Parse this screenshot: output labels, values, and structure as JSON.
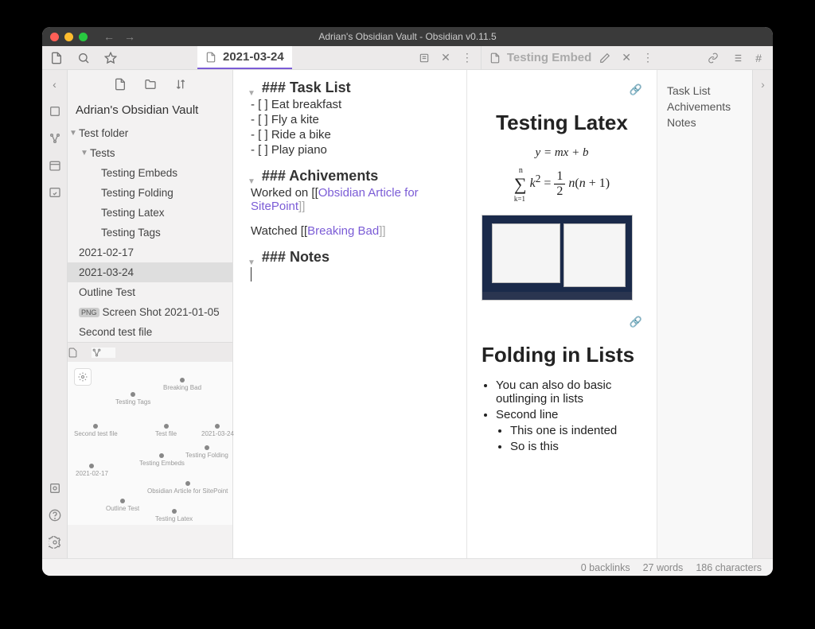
{
  "window": {
    "title": "Adrian's Obsidian Vault - Obsidian v0.11.5"
  },
  "tabs": {
    "editor": {
      "title": "2021-03-24"
    },
    "preview": {
      "title": "Testing Embed"
    }
  },
  "vault": {
    "name": "Adrian's Obsidian Vault"
  },
  "tree": {
    "root": "Test folder",
    "tests_folder": "Tests",
    "items": [
      "Testing Embeds",
      "Testing Folding",
      "Testing Latex",
      "Testing Tags"
    ],
    "files": [
      {
        "name": "2021-02-17"
      },
      {
        "name": "2021-03-24",
        "selected": true
      },
      {
        "name": "Outline Test"
      },
      {
        "name": "Screen Shot 2021-01-05",
        "badge": "PNG"
      },
      {
        "name": "Second test file"
      }
    ]
  },
  "graph_nodes": [
    "Breaking Bad",
    "Testing Tags",
    "Second test file",
    "Test file",
    "2021-03-24",
    "Testing Folding",
    "Testing Embeds",
    "2021-02-17",
    "Obsidian Article for SitePoint",
    "Outline Test",
    "Testing Latex"
  ],
  "editor": {
    "h1": "### Task List",
    "tasks": [
      "Eat breakfast",
      "Fly a kite",
      "Ride a bike",
      "Play piano"
    ],
    "h2": "### Achivements",
    "ach_pre1": "Worked on [[",
    "ach_link1": "Obsidian Article for SitePoint",
    "ach_post1": "]]",
    "ach_pre2": "Watched [[",
    "ach_link2": "Breaking Bad",
    "ach_post2": "]]",
    "h3": "### Notes"
  },
  "preview": {
    "h1a": "Testing Latex",
    "eq1": "y = mx + b",
    "eq2_html": "∑ k² = ½ n(n+1)",
    "sum_lower": "k=1",
    "sum_upper": "n",
    "h1b": "Folding in Lists",
    "bullets": [
      "You can also do basic outlinging in lists",
      "Second line"
    ],
    "sub_bullets": [
      "This one is indented",
      "So is this"
    ]
  },
  "outline": {
    "items": [
      "Task List",
      "Achivements",
      "Notes"
    ]
  },
  "status": {
    "backlinks": "0 backlinks",
    "words": "27 words",
    "chars": "186 characters"
  }
}
